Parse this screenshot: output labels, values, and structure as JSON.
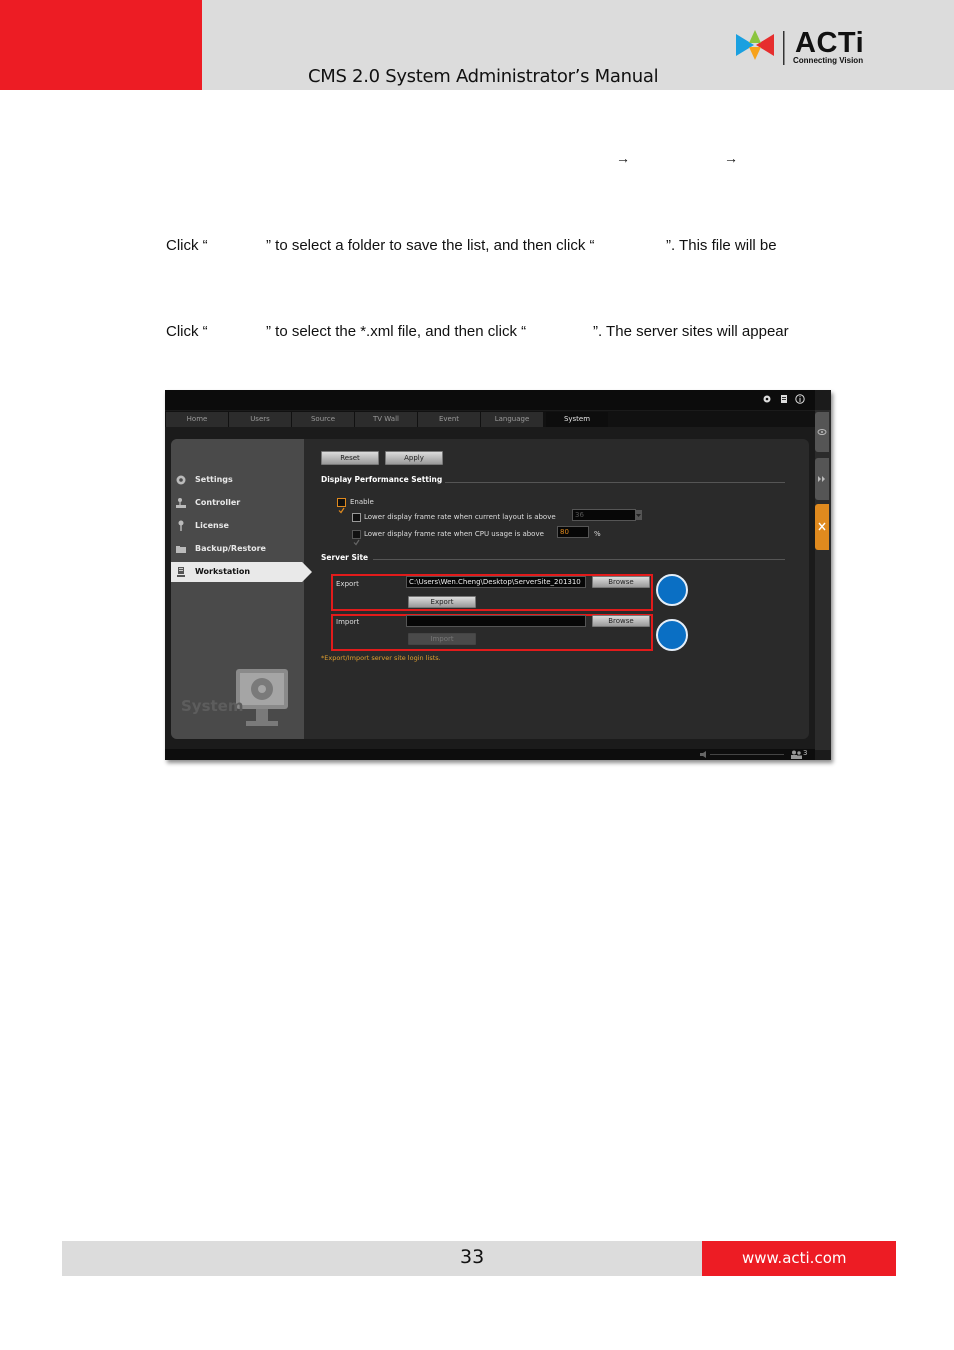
{
  "header": {
    "title": "CMS 2.0 System Administrator’s Manual",
    "logo_text": "ACTi",
    "logo_tagline": "Connecting Vision",
    "colors": {
      "accent_red": "#ed1c24",
      "bar_grey": "#dcdcdc"
    }
  },
  "body": {
    "arrow_glyph": "→",
    "export_sentence": {
      "click": "Click “",
      "middle": "” to select a folder to save the list, and then click “",
      "end": "”. This file will be"
    },
    "import_sentence": {
      "click": "Click “",
      "middle": "” to select the *.xml file, and then click “",
      "end": "”. The server sites will appear"
    }
  },
  "screenshot": {
    "tabs": [
      "Home",
      "Users",
      "Source",
      "TV Wall",
      "Event",
      "Language",
      "System"
    ],
    "active_tab": "System",
    "sidebar": [
      "Settings",
      "Controller",
      "License",
      "Backup/Restore",
      "Workstation"
    ],
    "sidebar_selected": "Workstation",
    "sidebar_footer": "System",
    "buttons": {
      "reset": "Reset",
      "apply": "Apply",
      "browse": "Browse",
      "export": "Export",
      "import": "Import"
    },
    "display_performance": {
      "title": "Display Performance Setting",
      "enable": "Enable",
      "enable_checked": true,
      "frame_rate_label": "Lower display frame rate when current layout is above",
      "frame_rate_value": "36",
      "frame_rate_checked": false,
      "cpu_label": "Lower display frame rate when CPU usage is above",
      "cpu_value": "80",
      "cpu_unit": "%",
      "cpu_checked": true
    },
    "server_site": {
      "title": "Server Site",
      "export_label": "Export",
      "export_path": "C:\\Users\\Wen.Cheng\\Desktop\\ServerSite_201310",
      "import_label": "Import",
      "import_path": "",
      "note": "*Export/Import server site login lists."
    },
    "status_count": "3",
    "colors": {
      "highlight_red": "#e21b1b",
      "callout_blue": "#0a6fc4",
      "orange_tab": "#e08a1e",
      "note_orange": "#e0a030"
    }
  },
  "footer": {
    "page_number": "33",
    "url": "www.acti.com"
  }
}
